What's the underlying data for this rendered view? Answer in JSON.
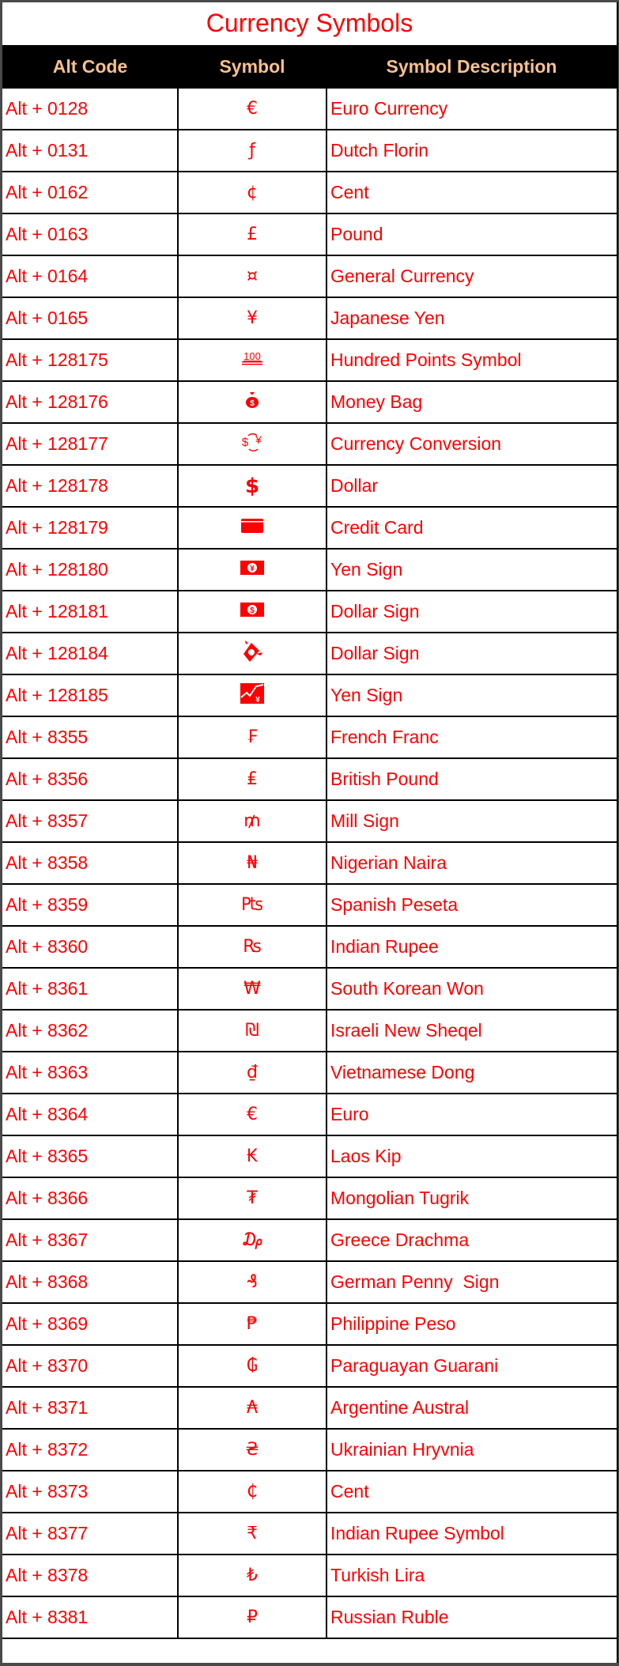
{
  "title": "Currency Symbols",
  "colors": {
    "text": "#ff0000",
    "header_bg": "#000000",
    "header_text": "#fac090"
  },
  "columns": [
    "Alt Code",
    "Symbol",
    "Symbol Description"
  ],
  "rows": [
    {
      "code": "Alt + 0128",
      "symbol": "€",
      "desc": "Euro Currency"
    },
    {
      "code": "Alt + 0131",
      "symbol": "ƒ",
      "desc": "Dutch Florin"
    },
    {
      "code": "Alt + 0162",
      "symbol": "¢",
      "desc": "Cent"
    },
    {
      "code": "Alt + 0163",
      "symbol": "£",
      "desc": "Pound"
    },
    {
      "code": "Alt + 0164",
      "symbol": "¤",
      "desc": "General Currency"
    },
    {
      "code": "Alt + 0165",
      "symbol": "¥",
      "desc": "Japanese Yen"
    },
    {
      "code": "Alt + 128175",
      "symbol": "",
      "icon": "hundred-points-icon",
      "desc": "Hundred Points Symbol"
    },
    {
      "code": "Alt + 128176",
      "symbol": "",
      "icon": "money-bag-icon",
      "desc": "Money Bag"
    },
    {
      "code": "Alt + 128177",
      "symbol": "",
      "icon": "currency-exchange-icon",
      "desc": "Currency Conversion"
    },
    {
      "code": "Alt + 128178",
      "symbol": "$",
      "icon": "heavy-dollar-icon",
      "desc": "Dollar"
    },
    {
      "code": "Alt + 128179",
      "symbol": "",
      "icon": "credit-card-icon",
      "desc": "Credit Card"
    },
    {
      "code": "Alt + 128180",
      "symbol": "",
      "icon": "yen-banknote-icon",
      "desc": "Yen Sign"
    },
    {
      "code": "Alt + 128181",
      "symbol": "",
      "icon": "dollar-banknote-icon",
      "desc": "Dollar Sign"
    },
    {
      "code": "Alt + 128184",
      "symbol": "",
      "icon": "money-with-wings-icon",
      "desc": "Dollar Sign"
    },
    {
      "code": "Alt + 128185",
      "symbol": "",
      "icon": "chart-yen-icon",
      "desc": "Yen Sign"
    },
    {
      "code": "Alt + 8355",
      "symbol": "₣",
      "desc": "French Franc"
    },
    {
      "code": "Alt + 8356",
      "symbol": "₤",
      "desc": "British Pound"
    },
    {
      "code": "Alt + 8357",
      "symbol": "₥",
      "desc": "Mill Sign"
    },
    {
      "code": "Alt + 8358",
      "symbol": "₦",
      "desc": "Nigerian Naira"
    },
    {
      "code": "Alt + 8359",
      "symbol": "₧",
      "desc": "Spanish Peseta"
    },
    {
      "code": "Alt + 8360",
      "symbol": "₨",
      "desc": "Indian Rupee"
    },
    {
      "code": "Alt + 8361",
      "symbol": "₩",
      "desc": "South Korean Won"
    },
    {
      "code": "Alt + 8362",
      "symbol": "₪",
      "desc": "Israeli New Sheqel"
    },
    {
      "code": "Alt + 8363",
      "symbol": "₫",
      "desc": "Vietnamese Dong"
    },
    {
      "code": "Alt + 8364",
      "symbol": "€",
      "desc": "Euro"
    },
    {
      "code": "Alt + 8365",
      "symbol": "₭",
      "desc": "Laos Kip"
    },
    {
      "code": "Alt + 8366",
      "symbol": "₮",
      "desc": "Mongolian Tugrik"
    },
    {
      "code": "Alt + 8367",
      "symbol": "₯",
      "desc": "Greece Drachma"
    },
    {
      "code": "Alt + 8368",
      "symbol": "₰",
      "desc": "German Penny  Sign"
    },
    {
      "code": "Alt + 8369",
      "symbol": "₱",
      "desc": "Philippine Peso"
    },
    {
      "code": "Alt + 8370",
      "symbol": "₲",
      "desc": "Paraguayan Guarani"
    },
    {
      "code": "Alt + 8371",
      "symbol": "₳",
      "desc": "Argentine Austral"
    },
    {
      "code": "Alt + 8372",
      "symbol": "₴",
      "desc": "Ukrainian Hryvnia"
    },
    {
      "code": "Alt + 8373",
      "symbol": "₵",
      "desc": "Cent"
    },
    {
      "code": "Alt + 8377",
      "symbol": "₹",
      "desc": "Indian Rupee Symbol"
    },
    {
      "code": "Alt + 8378",
      "symbol": "₺",
      "desc": "Turkish Lira"
    },
    {
      "code": "Alt + 8381",
      "symbol": "₽",
      "desc": "Russian Ruble"
    }
  ]
}
